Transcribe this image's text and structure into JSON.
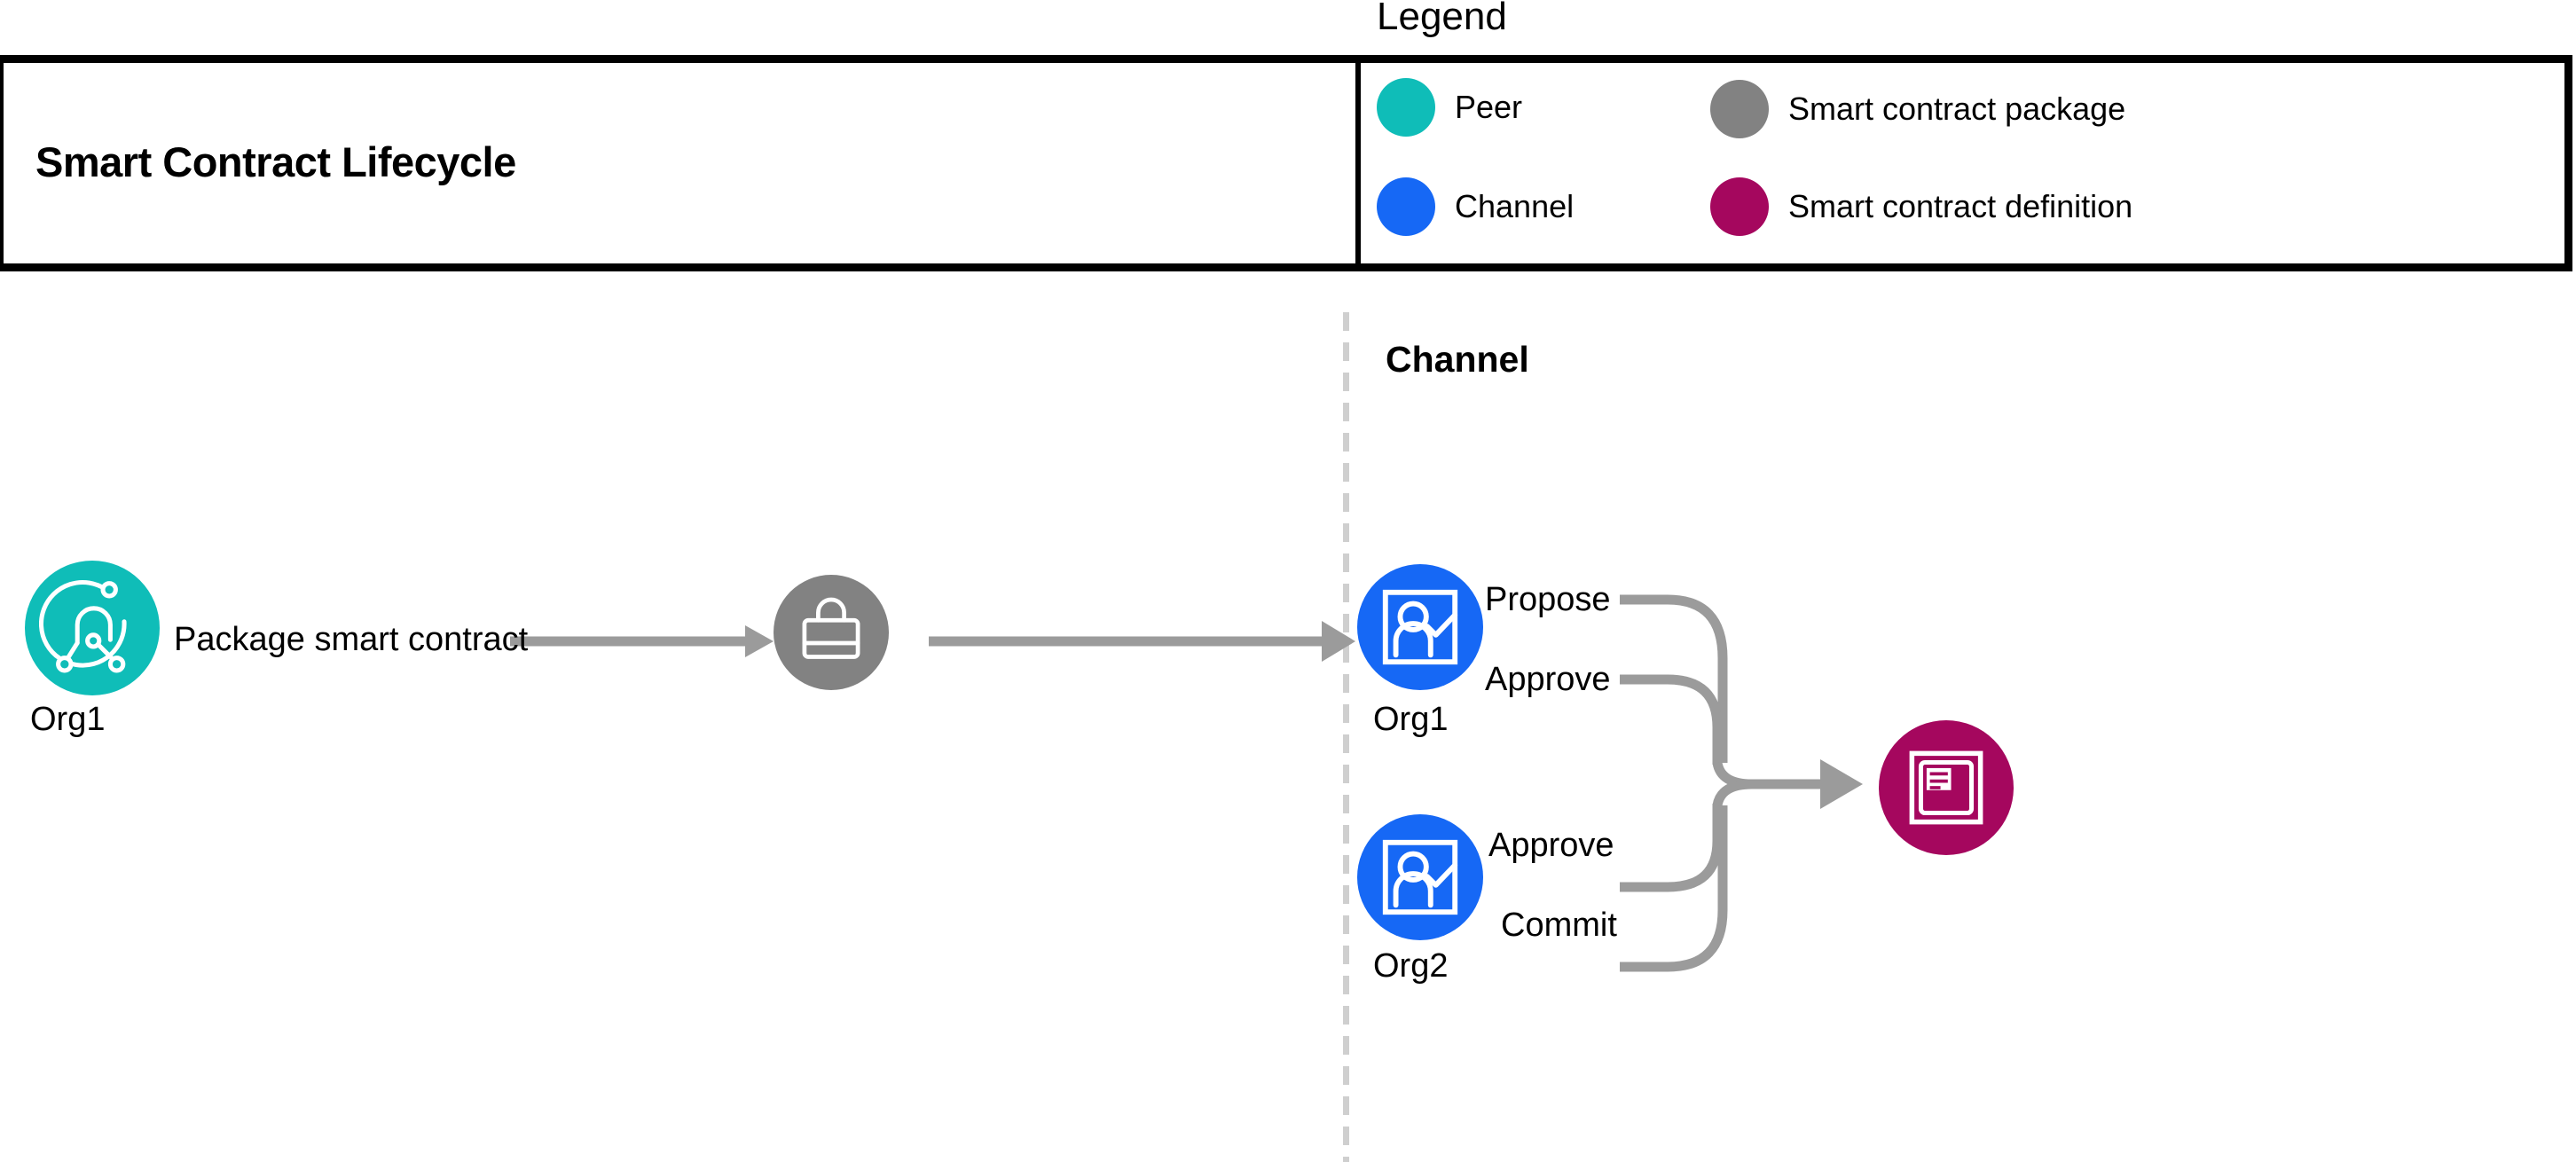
{
  "header": {
    "legend_title": "Legend",
    "page_title": "Smart Contract Lifecycle"
  },
  "legend": {
    "items": [
      {
        "label": "Peer",
        "color": "#0fbdb8",
        "icon": "peer-circle-swatch"
      },
      {
        "label": "Channel",
        "color": "#1668f5",
        "icon": "channel-circle-swatch"
      },
      {
        "label": "Smart contract package",
        "color": "#828282",
        "icon": "package-circle-swatch"
      },
      {
        "label": "Smart contract definition",
        "color": "#a5075e",
        "icon": "definition-circle-swatch"
      }
    ]
  },
  "diagram": {
    "channel_label": "Channel",
    "nodes": {
      "org1_peer": {
        "caption": "Org1",
        "color": "#0fbdb8",
        "icon": "peer-node-icon"
      },
      "package": {
        "caption": "",
        "color": "#828282",
        "icon": "briefcase-icon"
      },
      "org1_channel": {
        "caption": "Org1",
        "color": "#1668f5",
        "icon": "person-check-icon"
      },
      "org2_channel": {
        "caption": "Org2",
        "color": "#1668f5",
        "icon": "person-check-icon"
      },
      "definition": {
        "caption": "",
        "color": "#a5075e",
        "icon": "contract-document-icon"
      }
    },
    "flows": {
      "package_smart_contract": "Package smart contract",
      "propose": "Propose",
      "approve_org1": "Approve",
      "approve_org2": "Approve",
      "commit": "Commit"
    },
    "connector_color": "#9b9b9b",
    "divider_color": "#cfcfcf"
  }
}
